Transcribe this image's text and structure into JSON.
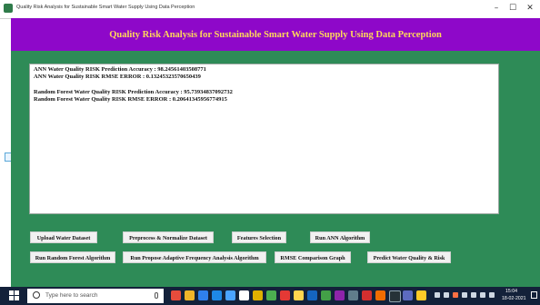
{
  "window": {
    "title": "Quality Risk Analysis for Sustainable Smart Water Supply Using Data Perception",
    "minimize": "–",
    "restore": "☐",
    "close": "✕"
  },
  "header": {
    "title": "Quality Risk Analysis for Sustainable Smart Water Supply Using Data Perception"
  },
  "output": {
    "lines": [
      "ANN Water Quality RISK Prediction Accuracy : 98.24561403508771",
      "ANN Water Quality RISK RMSE ERROR : 0.13245323570650439",
      "Random Forest Water Quality RISK Prediction Accuracy : 95.73934837092732",
      "Random Forest Water Quality RISK RMSE ERROR : 0.20641345956774915"
    ]
  },
  "buttons": {
    "upload": "Upload Water Dataset",
    "preprocess": "Preprocess & Normalize Dataset",
    "features": "Features Selection",
    "ann": "Run ANN Algorithm",
    "rf": "Run Random Forest Algorithm",
    "adaptive": "Run Propose Adaptive Frequency Analysis Algorithm",
    "rmse": "RMSE Comparison Graph",
    "predict": "Predict Water Quality & Risk"
  },
  "taskbar": {
    "search_placeholder": "Type here to search",
    "time": "15:04",
    "date": "18-02-2021",
    "colors": {
      "background": "#13213a",
      "main_green": "#2e8b57",
      "header_purple": "#8e08c9",
      "header_text": "#ffd95a"
    }
  }
}
